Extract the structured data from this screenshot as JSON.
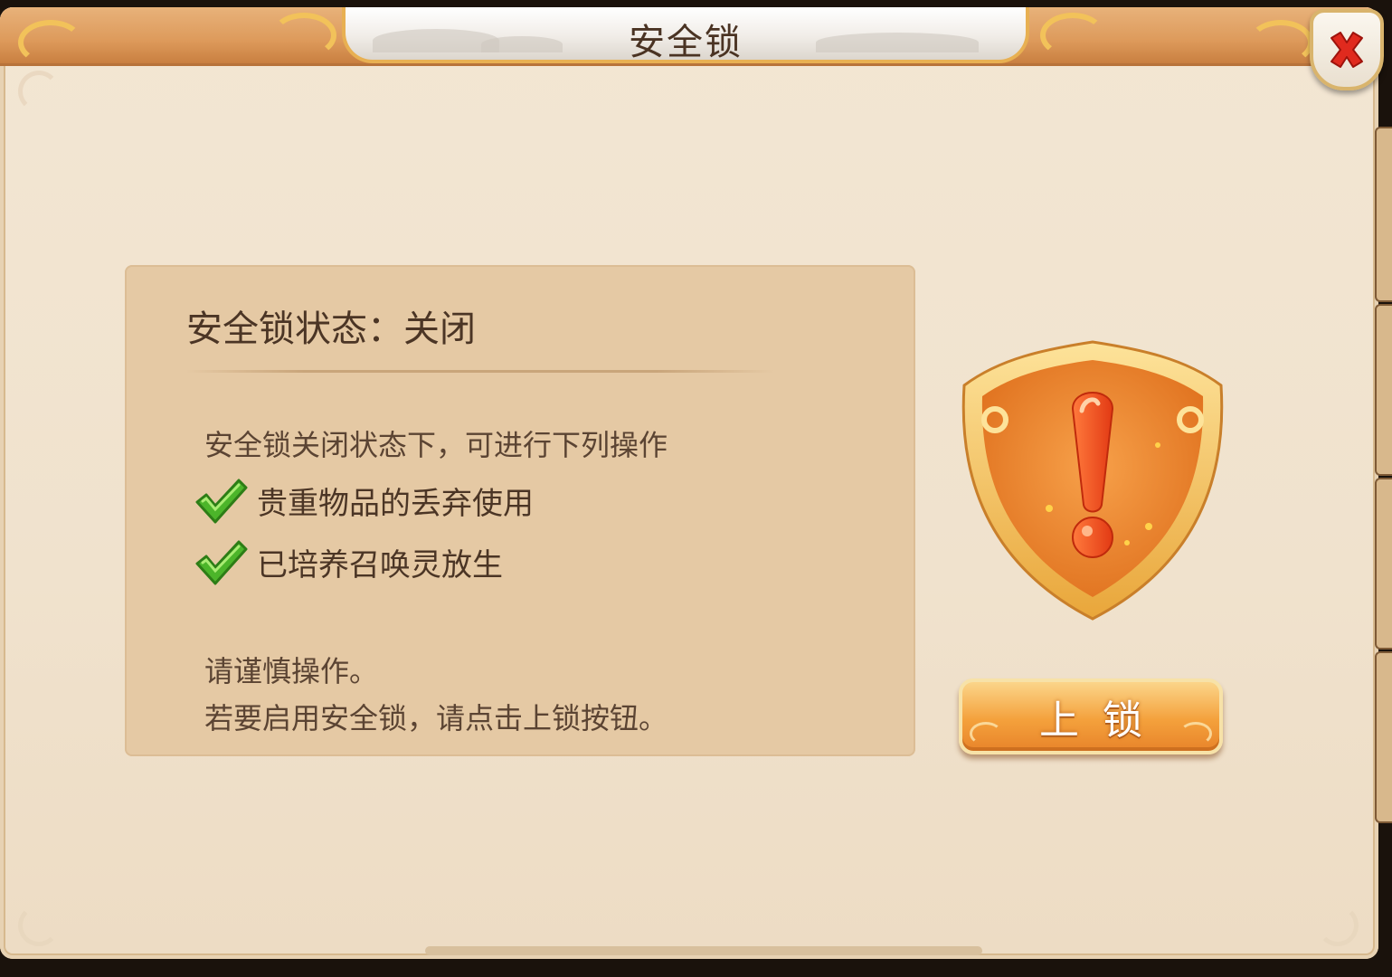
{
  "dialog": {
    "title": "安全锁",
    "close_icon": "close-x-icon"
  },
  "status_panel": {
    "status_title": "安全锁状态：关闭",
    "intro": "安全锁关闭状态下，可进行下列操作",
    "permissions": [
      {
        "icon": "green-check-icon",
        "label": "贵重物品的丢弃使用"
      },
      {
        "icon": "green-check-icon",
        "label": "已培养召唤灵放生"
      }
    ],
    "caution": "请谨慎操作。",
    "hint": "若要启用安全锁，请点击上锁按钮。"
  },
  "shield": {
    "icon": "warning-shield-icon",
    "color": "#f08a2e"
  },
  "lock_button": {
    "label": "上锁"
  },
  "colors": {
    "frame_bg": "#f0e2cd",
    "panel_bg": "#e5c9a4",
    "titlebar": "#dd9a5b",
    "accent_gold": "#f2c25a",
    "close_red": "#e02a1e",
    "check_green": "#4cb52a"
  }
}
